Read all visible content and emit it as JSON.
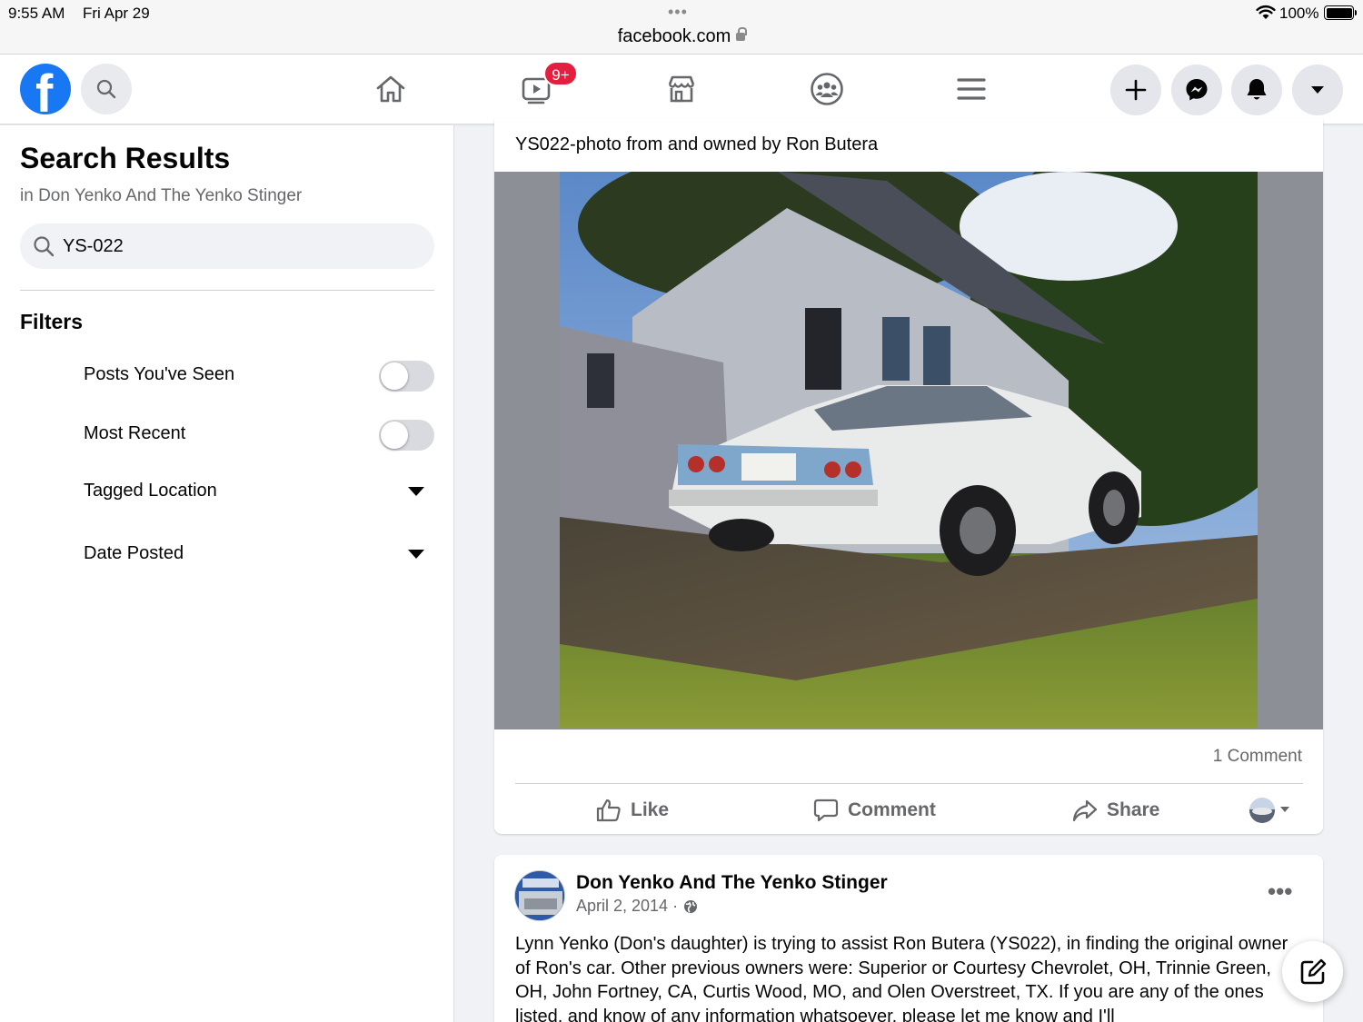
{
  "status_bar": {
    "time": "9:55 AM",
    "date": "Fri Apr 29",
    "url": "facebook.com",
    "battery": "100%"
  },
  "nav": {
    "logo_letter": "f",
    "watch_badge": "9+",
    "icons": [
      "facebook-logo",
      "search-icon",
      "home-icon",
      "watch-icon",
      "marketplace-icon",
      "groups-icon",
      "menu-icon",
      "plus-icon",
      "messenger-icon",
      "notifications-icon",
      "account-caret-icon"
    ]
  },
  "sidebar": {
    "title": "Search Results",
    "subtitle": "in Don Yenko And The Yenko Stinger",
    "search_value": "YS-022",
    "filters_title": "Filters",
    "filters": [
      {
        "label": "Posts You've Seen",
        "type": "toggle",
        "on": false
      },
      {
        "label": "Most Recent",
        "type": "toggle",
        "on": false
      },
      {
        "label": "Tagged Location",
        "type": "dropdown"
      },
      {
        "label": "Date Posted",
        "type": "dropdown"
      }
    ]
  },
  "post1": {
    "caption": "YS022-photo from and owned by Ron Butera",
    "comments_count": "1 Comment",
    "actions": {
      "like": "Like",
      "comment": "Comment",
      "share": "Share"
    }
  },
  "post2": {
    "page_name": "Don Yenko And The Yenko Stinger",
    "date": "April 2, 2014 ·",
    "text": "Lynn Yenko (Don's daughter) is trying to assist Ron Butera (YS022), in finding the original owner of Ron's car. Other previous owners were: Superior or Courtesy Chevrolet, OH, Trinnie Green, OH, John Fortney, CA, Curtis Wood, MO, and Olen Overstreet, TX. If you are any of the ones listed, and know of any information whatsoever, please let me know and I'll"
  },
  "colors": {
    "brand": "#1877f2",
    "badge": "#e41e3f",
    "secondary_text": "#65676b",
    "background": "#f0f2f5"
  }
}
